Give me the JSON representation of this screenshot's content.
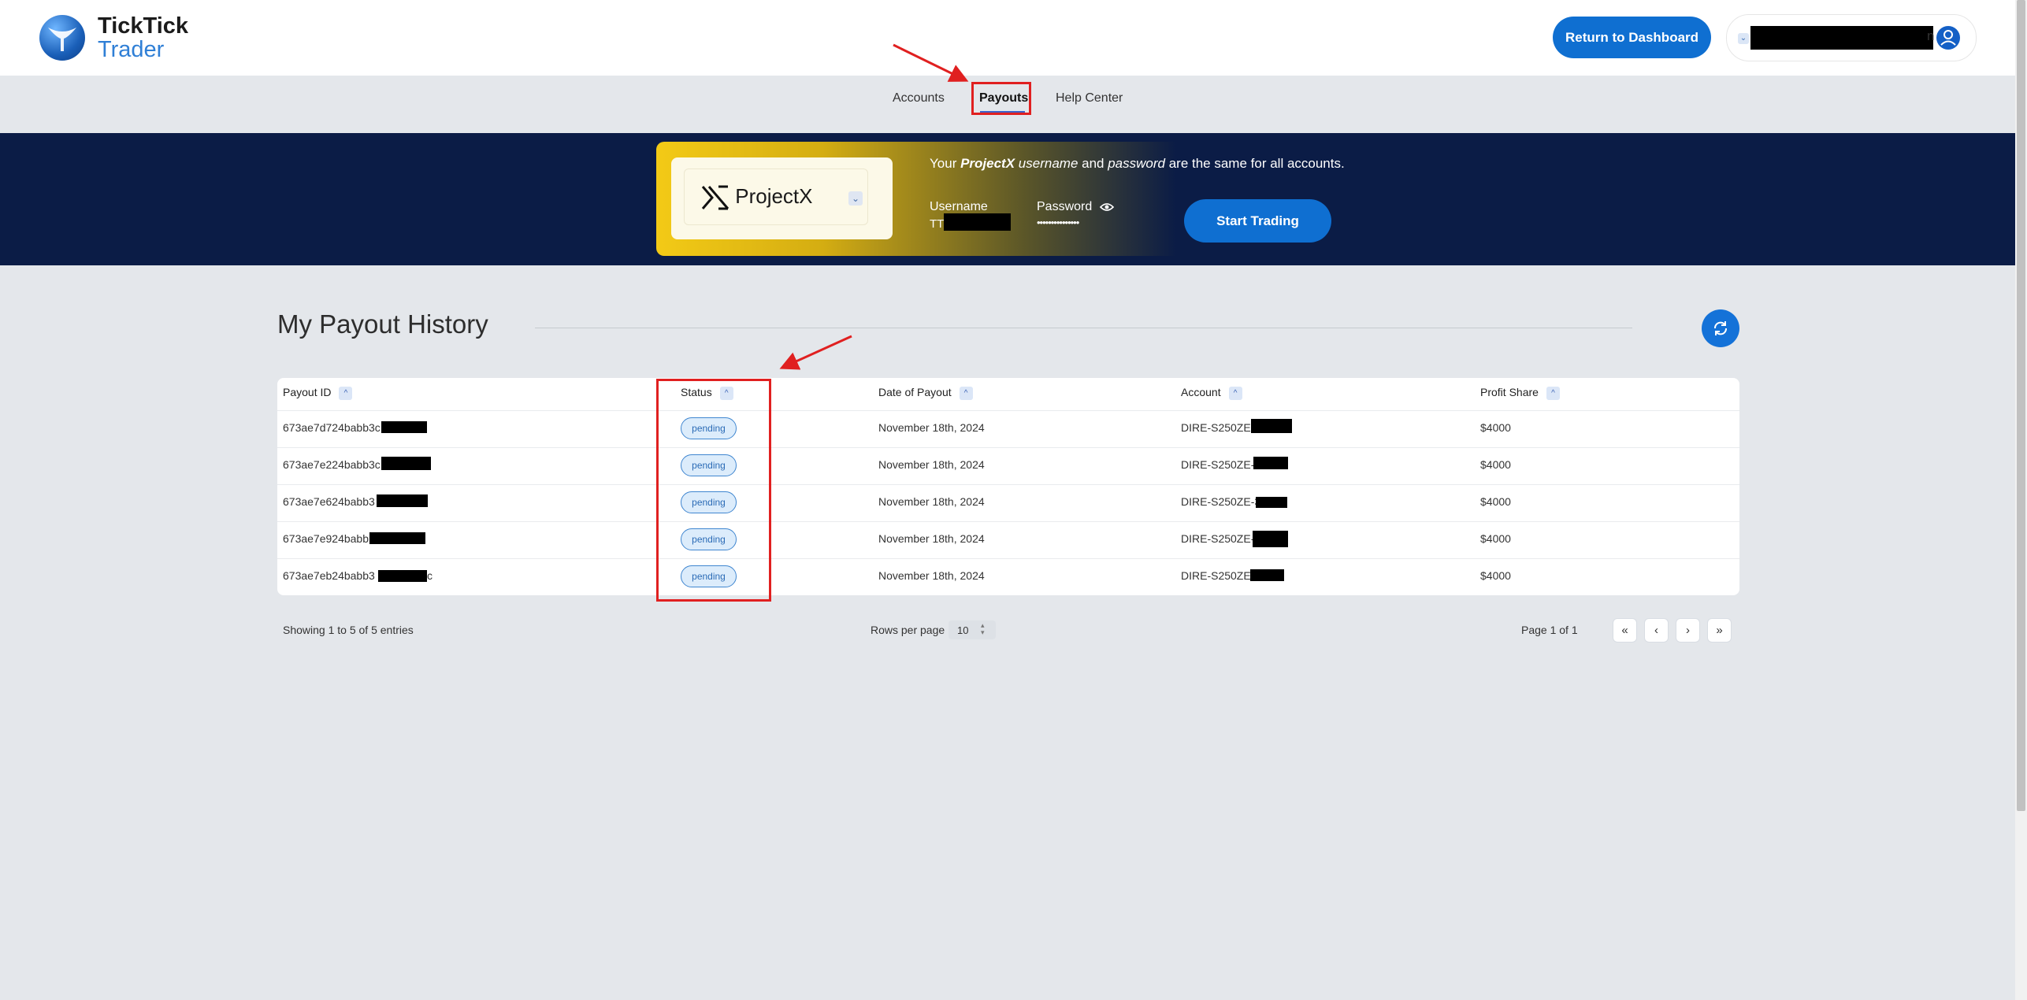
{
  "app": {
    "brand_line1": "TickTick",
    "brand_line2": "Trader",
    "return_label": "Return to Dashboard",
    "user_suffix": "n"
  },
  "nav": {
    "items": [
      {
        "label": "Accounts"
      },
      {
        "label": "Payouts",
        "active": true
      },
      {
        "label": "Help Center"
      }
    ]
  },
  "banner": {
    "platform": "ProjectX",
    "info_pre": "Your ",
    "info_brand": "ProjectX",
    "info_username_word": "username",
    "info_and": " and ",
    "info_password_word": "password",
    "info_post": " are the same for all accounts.",
    "username_label": "Username",
    "username_prefix": "TT",
    "password_label": "Password",
    "password_mask": "•••••••••••••••",
    "start_label": "Start Trading"
  },
  "page": {
    "title": "My Payout History"
  },
  "table": {
    "columns": [
      "Payout ID",
      "Status",
      "Date of Payout",
      "Account",
      "Profit Share"
    ],
    "rows": [
      {
        "id": "673ae7d724babb3c",
        "status": "pending",
        "date": "November 18th, 2024",
        "account": "DIRE-S250ZE-",
        "profit": "$4000"
      },
      {
        "id": "673ae7e224babb3c",
        "status": "pending",
        "date": "November 18th, 2024",
        "account": "DIRE-S250ZE-",
        "profit": "$4000"
      },
      {
        "id": "673ae7e624babb3",
        "status": "pending",
        "date": "November 18th, 2024",
        "account": "DIRE-S250ZE-3",
        "profit": "$4000"
      },
      {
        "id": "673ae7e924babb",
        "status": "pending",
        "date": "November 18th, 2024",
        "account": "DIRE-S250ZE-",
        "profit": "$4000"
      },
      {
        "id": "673ae7eb24babb3",
        "id_suffix": "c",
        "status": "pending",
        "date": "November 18th, 2024",
        "account": "DIRE-S250ZE-",
        "profit": "$4000"
      }
    ]
  },
  "footer": {
    "showing": "Showing 1 to 5 of 5 entries",
    "rows_per_page_label": "Rows per page",
    "rows_per_page_value": "10",
    "page_info": "Page 1 of 1",
    "first": "«",
    "prev": "‹",
    "next": "›",
    "last": "»"
  },
  "colors": {
    "accent": "#0f6fd1",
    "banner_bg": "#0b1c46",
    "annotation": "#e02020"
  }
}
